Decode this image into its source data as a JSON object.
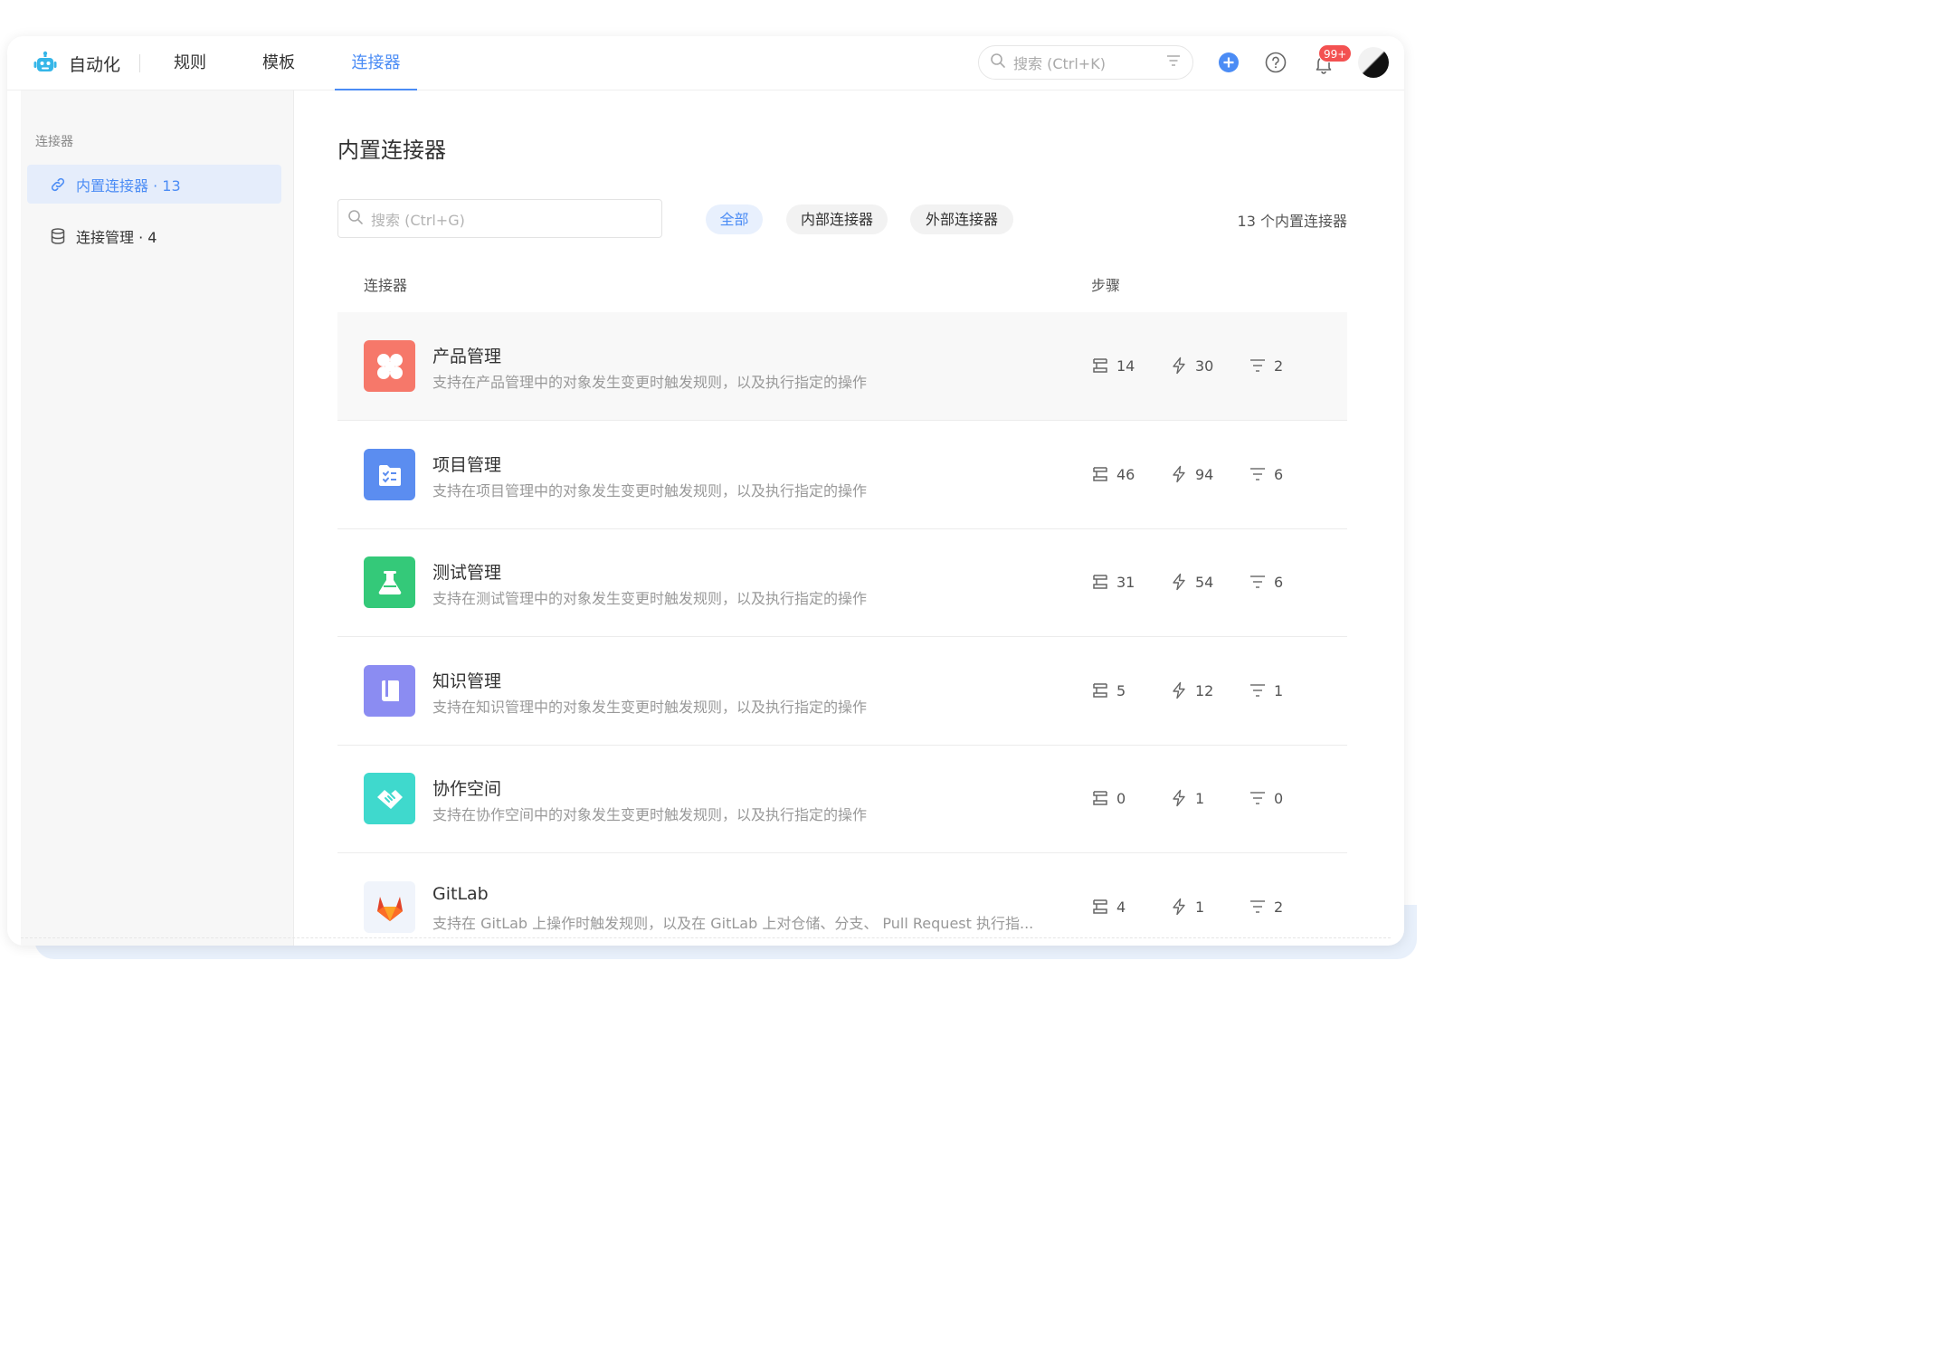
{
  "app": {
    "title": "自动化"
  },
  "nav": {
    "tabs": [
      {
        "label": "规则"
      },
      {
        "label": "模板"
      },
      {
        "label": "连接器"
      }
    ],
    "active_tab": "连接器",
    "search_placeholder": "搜索 (Ctrl+K)",
    "notification_badge": "99+"
  },
  "sidebar": {
    "section_title": "连接器",
    "items": [
      {
        "label": "内置连接器 · 13",
        "icon": "link-icon",
        "active": true
      },
      {
        "label": "连接管理 · 4",
        "icon": "database-icon",
        "active": false
      }
    ]
  },
  "main": {
    "title": "内置连接器",
    "search_placeholder": "搜索 (Ctrl+G)",
    "filters": [
      {
        "label": "全部",
        "active": true
      },
      {
        "label": "内部连接器",
        "active": false
      },
      {
        "label": "外部连接器",
        "active": false
      }
    ],
    "count_text": "13 个内置连接器",
    "columns": {
      "connector": "连接器",
      "steps": "步骤"
    },
    "rows": [
      {
        "name": "产品管理",
        "desc": "支持在产品管理中的对象发生变更时触发规则，以及执行指定的操作",
        "icon": "product-icon",
        "color": "#f6786a",
        "steps": "14",
        "triggers": "30",
        "conditions": "2"
      },
      {
        "name": "项目管理",
        "desc": "支持在项目管理中的对象发生变更时触发规则，以及执行指定的操作",
        "icon": "project-icon",
        "color": "#5b8df0",
        "steps": "46",
        "triggers": "94",
        "conditions": "6"
      },
      {
        "name": "测试管理",
        "desc": "支持在测试管理中的对象发生变更时触发规则，以及执行指定的操作",
        "icon": "flask-icon",
        "color": "#34c979",
        "steps": "31",
        "triggers": "54",
        "conditions": "6"
      },
      {
        "name": "知识管理",
        "desc": "支持在知识管理中的对象发生变更时触发规则，以及执行指定的操作",
        "icon": "book-icon",
        "color": "#8b8cf2",
        "steps": "5",
        "triggers": "12",
        "conditions": "1"
      },
      {
        "name": "协作空间",
        "desc": "支持在协作空间中的对象发生变更时触发规则，以及执行指定的操作",
        "icon": "handshake-icon",
        "color": "#3fd9cd",
        "steps": "0",
        "triggers": "1",
        "conditions": "0"
      },
      {
        "name": "GitLab",
        "desc": "支持在 GitLab 上操作时触发规则，以及在 GitLab 上对仓储、分支、 Pull Request 执行指...",
        "icon": "gitlab-icon",
        "color": "#f0f4fb",
        "steps": "4",
        "triggers": "1",
        "conditions": "2"
      }
    ]
  },
  "colors": {
    "accent": "#4b8cf5",
    "badge": "#f35151"
  }
}
